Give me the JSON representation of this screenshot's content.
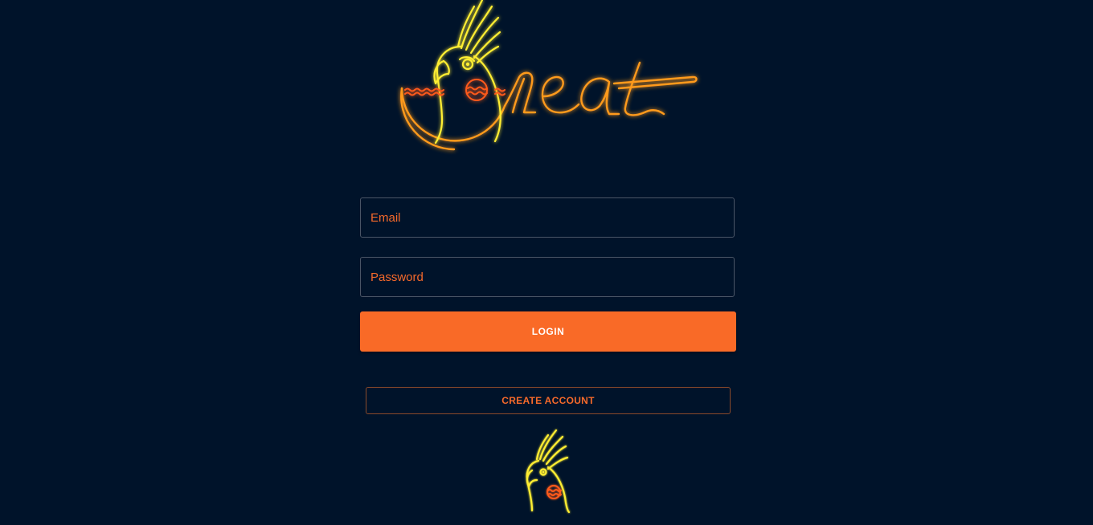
{
  "login_form": {
    "email": {
      "value": "",
      "placeholder": "Email"
    },
    "password": {
      "value": "",
      "placeholder": "Password"
    },
    "login_label": "LOGIN",
    "create_account_label": "CREATE ACCOUNT"
  },
  "branding": {
    "logo_icon": "neon-cockatiel-neat-logo-icon",
    "footer_icon": "neon-cockatiel-icon"
  },
  "colors": {
    "background": "#00132a",
    "accent": "#f96a27",
    "neon_yellow": "#ffee33",
    "neon_orange": "#ff9a1a"
  }
}
